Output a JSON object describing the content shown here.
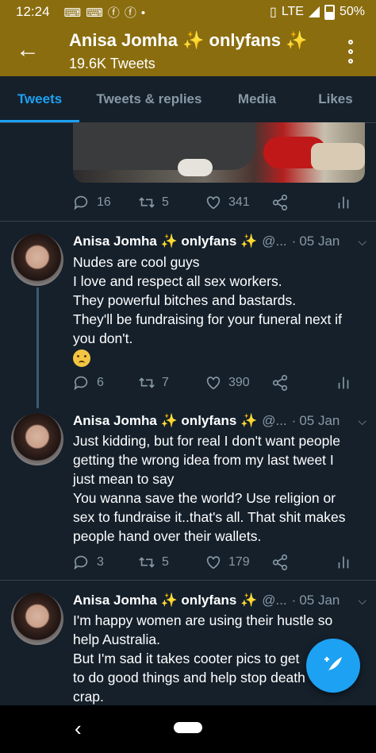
{
  "status_bar": {
    "time": "12:24",
    "notification_icons": [
      "gamepad-icon",
      "gamepad-icon",
      "facebook-icon",
      "facebook-icon",
      "dot-icon"
    ],
    "network": "LTE",
    "battery": "50%"
  },
  "header": {
    "name": "Anisa Jomha ✨ onlyfans ✨",
    "tweet_count": "19.6K Tweets"
  },
  "tabs": [
    {
      "label": "Tweets",
      "active": true
    },
    {
      "label": "Tweets & replies",
      "active": false
    },
    {
      "label": "Media",
      "active": false
    },
    {
      "label": "Likes",
      "active": false
    }
  ],
  "first_tweet_actions": {
    "replies": "16",
    "retweets": "5",
    "likes": "341"
  },
  "tweets": [
    {
      "name": "Anisa Jomha ✨ onlyfans ✨",
      "handle": "@...",
      "date": "05 Jan",
      "lines": [
        "Nudes are cool guys",
        "I love and respect all sex workers.",
        "They powerful bitches and bastards.",
        "They'll be fundraising for your funeral next if",
        "you don't."
      ],
      "emoji": "pleading-face-emoji",
      "replies": "6",
      "retweets": "7",
      "likes": "390"
    },
    {
      "name": "Anisa Jomha ✨ onlyfans ✨",
      "handle": "@...",
      "date": "05 Jan",
      "lines": [
        "Just kidding, but for real I don't want people",
        "getting the wrong idea from my last tweet I",
        "just mean to say",
        "You wanna save the world? Use religion or",
        "sex to fundraise it..that's all. That shit makes",
        "people hand over their wallets."
      ],
      "replies": "3",
      "retweets": "5",
      "likes": "179"
    },
    {
      "name": "Anisa Jomha ✨ onlyfans ✨",
      "handle": "@...",
      "date": "05 Jan",
      "lines": [
        "I'm happy women are using their hustle so",
        "help Australia.",
        "But I'm sad it takes cooter pics to get",
        "to do good things and help stop death",
        "crap."
      ]
    }
  ],
  "colors": {
    "header_bg": "#8a6d0f",
    "page_bg": "#15202b",
    "accent": "#1da1f2",
    "muted": "#8899a6"
  }
}
